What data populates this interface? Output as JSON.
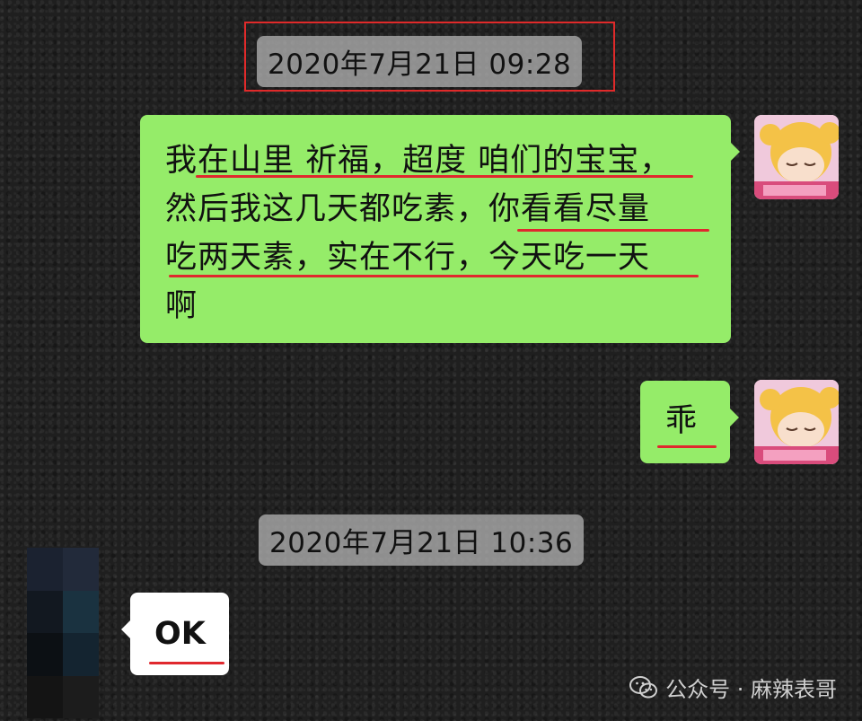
{
  "chat": {
    "timestamp_1": "2020年7月21日 09:28",
    "timestamp_2": "2020年7月21日 10:36",
    "messages": [
      {
        "sender": "self",
        "lines": [
          "我在山里 祈福，超度 咱们的宝宝，",
          "然后我这几天都吃素，你看看尽量",
          "吃两天素，实在不行，今天吃一天",
          "啊"
        ]
      },
      {
        "sender": "self",
        "text": "乖"
      },
      {
        "sender": "other",
        "text": "OK"
      }
    ]
  },
  "watermark": {
    "icon": "wechat-icon",
    "text": "公众号 · 麻辣表哥"
  },
  "colors": {
    "self_bubble": "#95ec69",
    "other_bubble": "#ffffff",
    "underline": "#e0282e",
    "highlight_box": "#e02a2a"
  }
}
